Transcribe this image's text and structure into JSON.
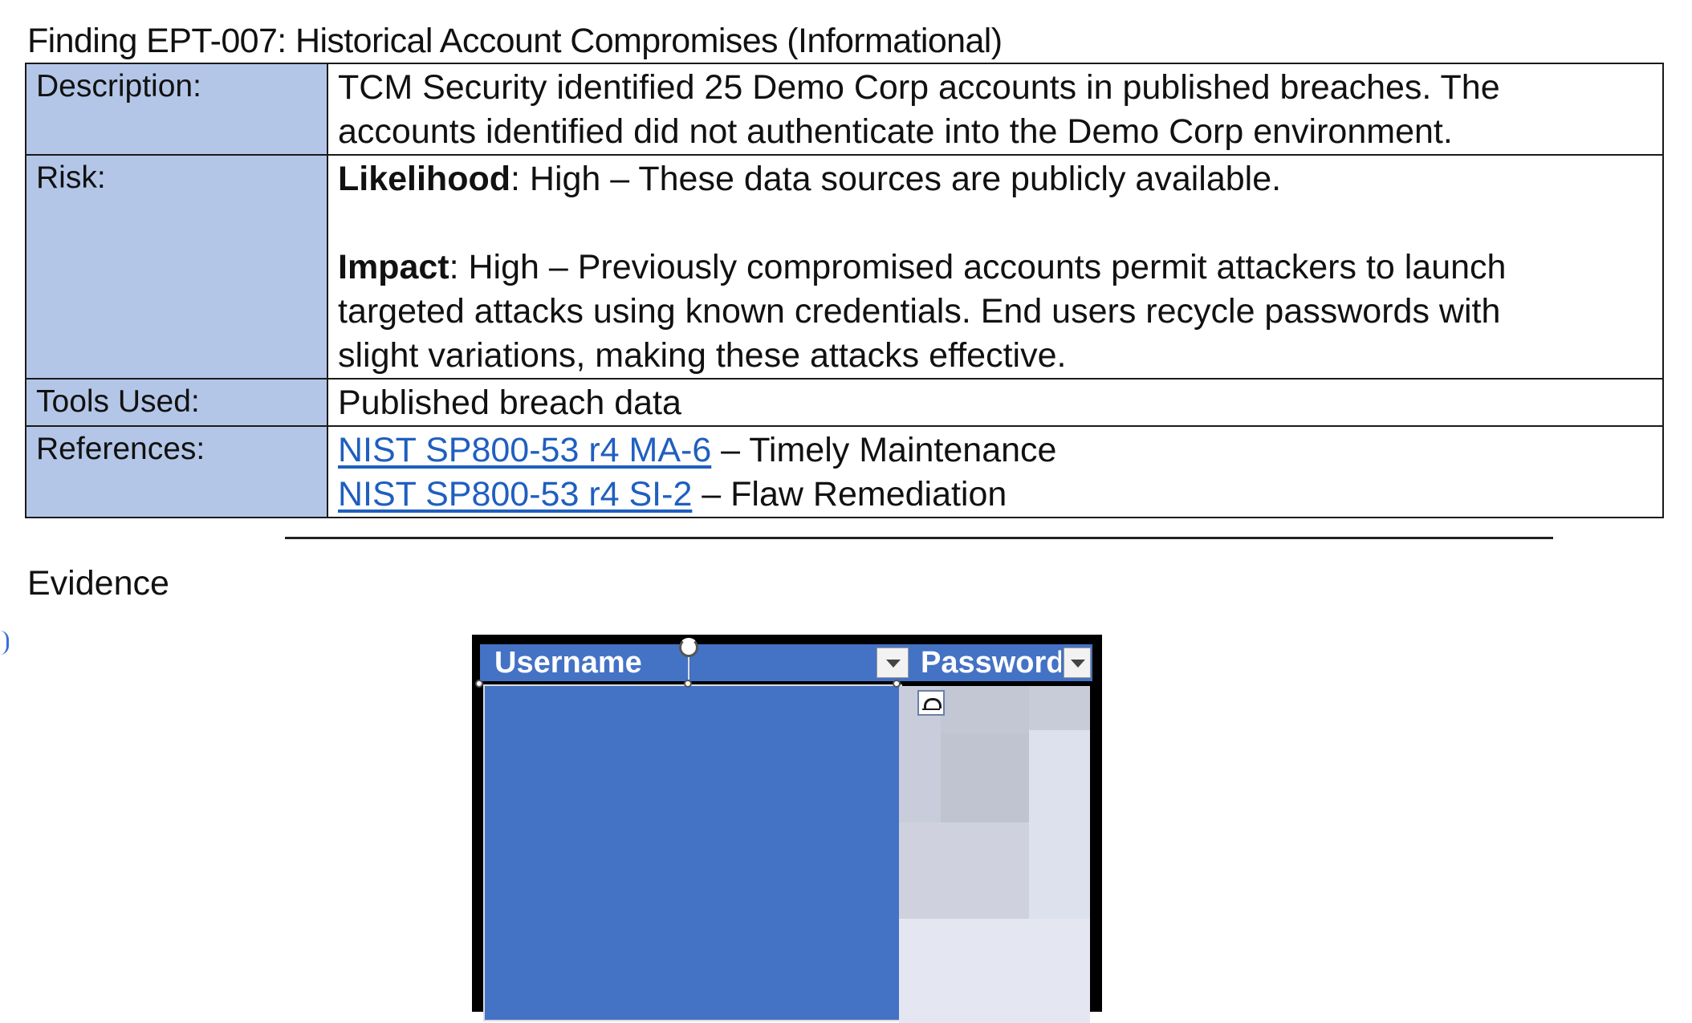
{
  "finding": {
    "title": "Finding EPT-007: Historical Account Compromises (Informational)",
    "rows": {
      "description": {
        "label": "Description:",
        "lines": [
          "TCM Security identified 25 Demo Corp accounts in published breaches.  The",
          "accounts identified did not authenticate into the Demo Corp environment."
        ]
      },
      "risk": {
        "label": "Risk:",
        "likelihood_label": "Likelihood",
        "likelihood_text": ": High – These data sources are publicly available.",
        "impact_label": "Impact",
        "impact_line1": ": High – Previously compromised accounts permit attackers to launch",
        "impact_line2": "targeted attacks using known credentials.  End users recycle passwords with",
        "impact_line3": "slight variations, making these attacks effective."
      },
      "tools": {
        "label": "Tools Used:",
        "value": "Published breach data"
      },
      "references": {
        "label": "References:",
        "items": [
          {
            "link": "NIST SP800-53 r4 MA-6",
            "text": " – Timely Maintenance"
          },
          {
            "link": "NIST SP800-53 r4 SI-2",
            "text": " – Flaw Remediation"
          }
        ]
      }
    }
  },
  "evidence": {
    "heading": "Evidence",
    "screenshot": {
      "columns": [
        "Username",
        "Password"
      ],
      "header_color": "#4472c4",
      "username_column": "redacted",
      "password_column": "blurred",
      "icons": [
        "filter-dropdown-icon",
        "rotate-handle-icon",
        "layout-options-icon"
      ]
    }
  },
  "colors": {
    "label_cell_bg": "#b4c6e7",
    "link": "#1f5fbf",
    "border": "#1a1a1a"
  }
}
